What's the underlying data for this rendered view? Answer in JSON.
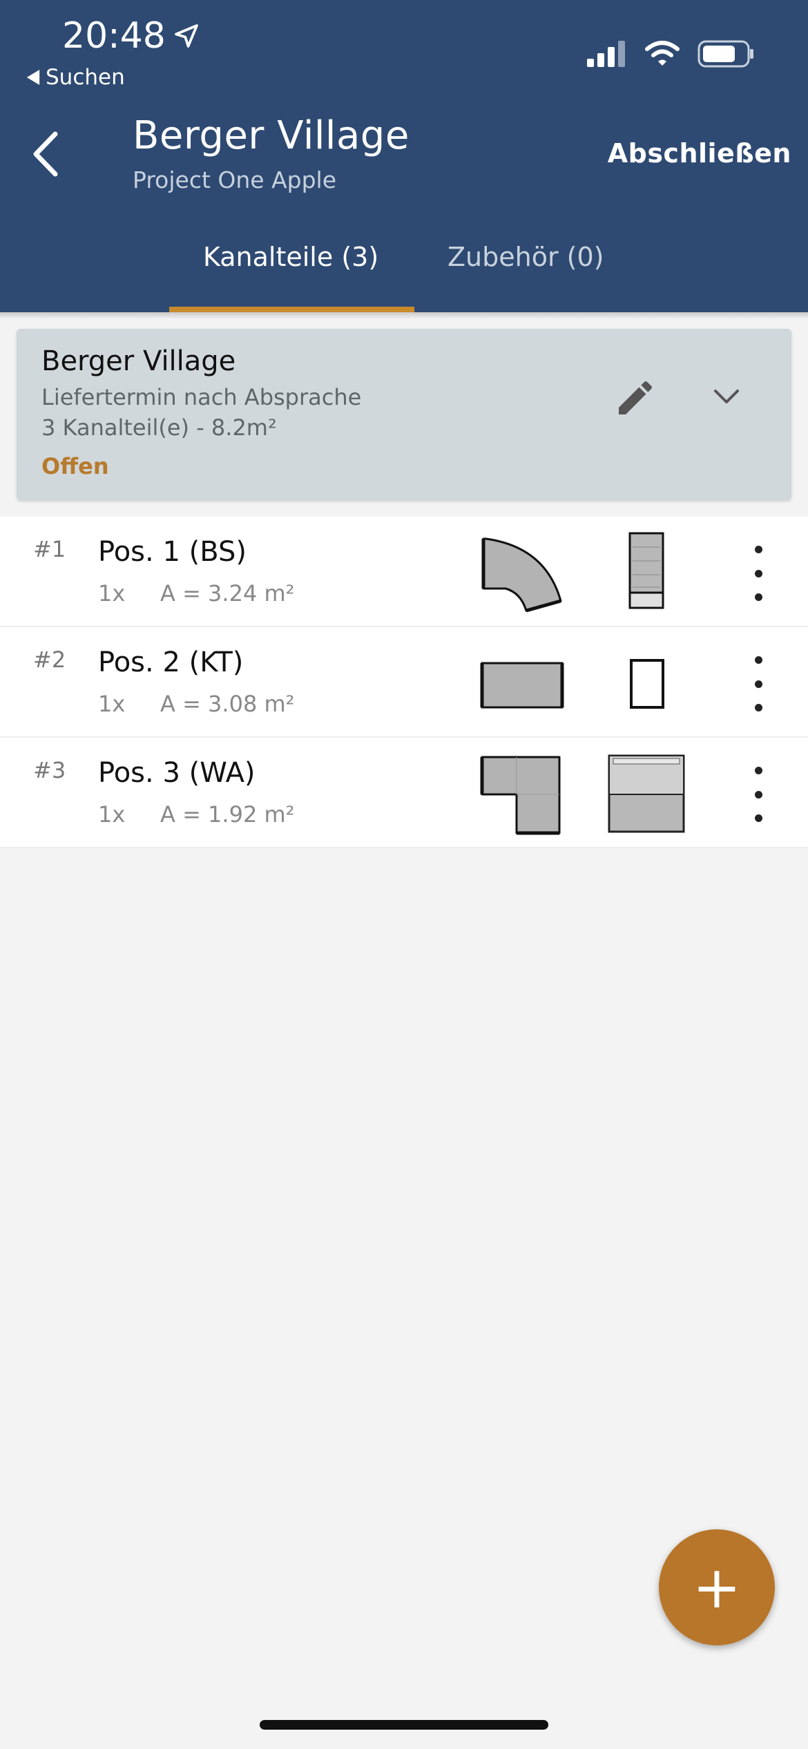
{
  "status_bar": {
    "time": "20:48",
    "back_label": "Suchen"
  },
  "header": {
    "title": "Berger Village",
    "subtitle": "Project One Apple",
    "action_label": "Abschließen"
  },
  "tabs": [
    {
      "label": "Kanalteile (3)",
      "active": true
    },
    {
      "label": "Zubehör (0)",
      "active": false
    }
  ],
  "project_card": {
    "name": "Berger Village",
    "delivery": "Liefertermin nach Absprache",
    "summary": "3 Kanalteil(e) - 8.2m²",
    "status": "Offen"
  },
  "items": [
    {
      "index": "#1",
      "name": "Pos. 1 (BS)",
      "qty": "1x",
      "area": "A = 3.24 m²",
      "shape": "bend"
    },
    {
      "index": "#2",
      "name": "Pos. 2 (KT)",
      "qty": "1x",
      "area": "A = 3.08 m²",
      "shape": "straight"
    },
    {
      "index": "#3",
      "name": "Pos. 3 (WA)",
      "qty": "1x",
      "area": "A = 1.92 m²",
      "shape": "angle"
    }
  ],
  "fab_label": "+",
  "colors": {
    "header": "#2e4a72",
    "accent": "#b8762a",
    "card": "#d1d8dc"
  }
}
